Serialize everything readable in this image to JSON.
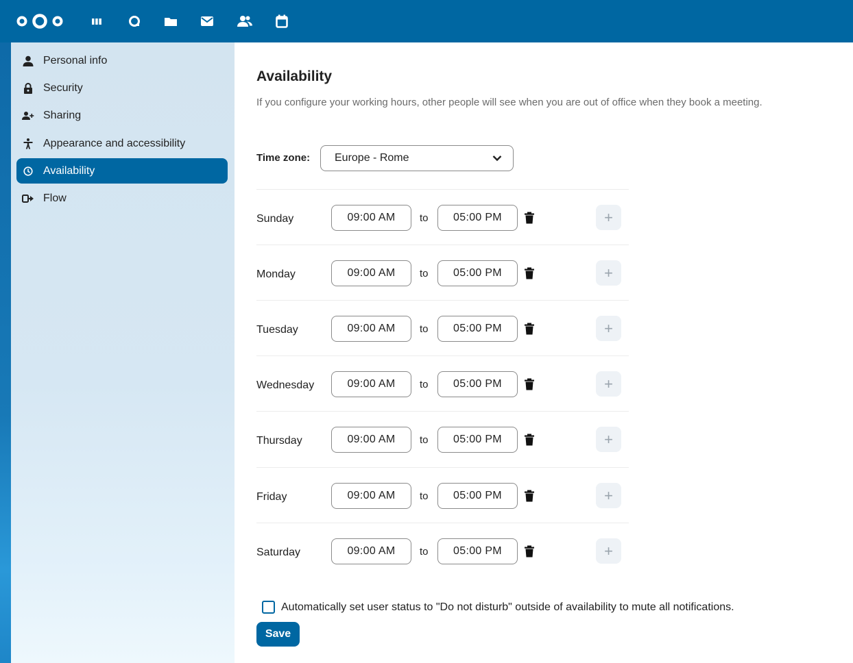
{
  "header": {
    "apps": [
      {
        "name": "dashboard-icon"
      },
      {
        "name": "search-icon"
      },
      {
        "name": "files-icon"
      },
      {
        "name": "mail-icon"
      },
      {
        "name": "contacts-icon"
      },
      {
        "name": "calendar-icon"
      }
    ]
  },
  "sidebar": {
    "items": [
      {
        "label": "Personal info",
        "icon": "user-icon"
      },
      {
        "label": "Security",
        "icon": "lock-icon"
      },
      {
        "label": "Sharing",
        "icon": "share-user-icon"
      },
      {
        "label": "Appearance and accessibility",
        "icon": "accessibility-icon"
      },
      {
        "label": "Availability",
        "icon": "clock-icon",
        "active": true
      },
      {
        "label": "Flow",
        "icon": "flow-icon"
      }
    ]
  },
  "main": {
    "title": "Availability",
    "description": "If you configure your working hours, other people will see when you are out of office when they book a meeting.",
    "timezone": {
      "label": "Time zone:",
      "value": "Europe - Rome"
    },
    "to_label": "to",
    "days": [
      {
        "name": "Sunday",
        "from": "09:00 AM",
        "to": "05:00 PM"
      },
      {
        "name": "Monday",
        "from": "09:00 AM",
        "to": "05:00 PM"
      },
      {
        "name": "Tuesday",
        "from": "09:00 AM",
        "to": "05:00 PM"
      },
      {
        "name": "Wednesday",
        "from": "09:00 AM",
        "to": "05:00 PM"
      },
      {
        "name": "Thursday",
        "from": "09:00 AM",
        "to": "05:00 PM"
      },
      {
        "name": "Friday",
        "from": "09:00 AM",
        "to": "05:00 PM"
      },
      {
        "name": "Saturday",
        "from": "09:00 AM",
        "to": "05:00 PM"
      }
    ],
    "add_symbol": "+",
    "dnd_label": "Automatically set user status to \"Do not disturb\" outside of availability to mute all notifications.",
    "dnd_checked": false,
    "save_label": "Save"
  },
  "colors": {
    "primary": "#0067a2",
    "sidebar_bg": "#d6e7f3",
    "text": "#222222",
    "muted": "#6b6b6b"
  }
}
